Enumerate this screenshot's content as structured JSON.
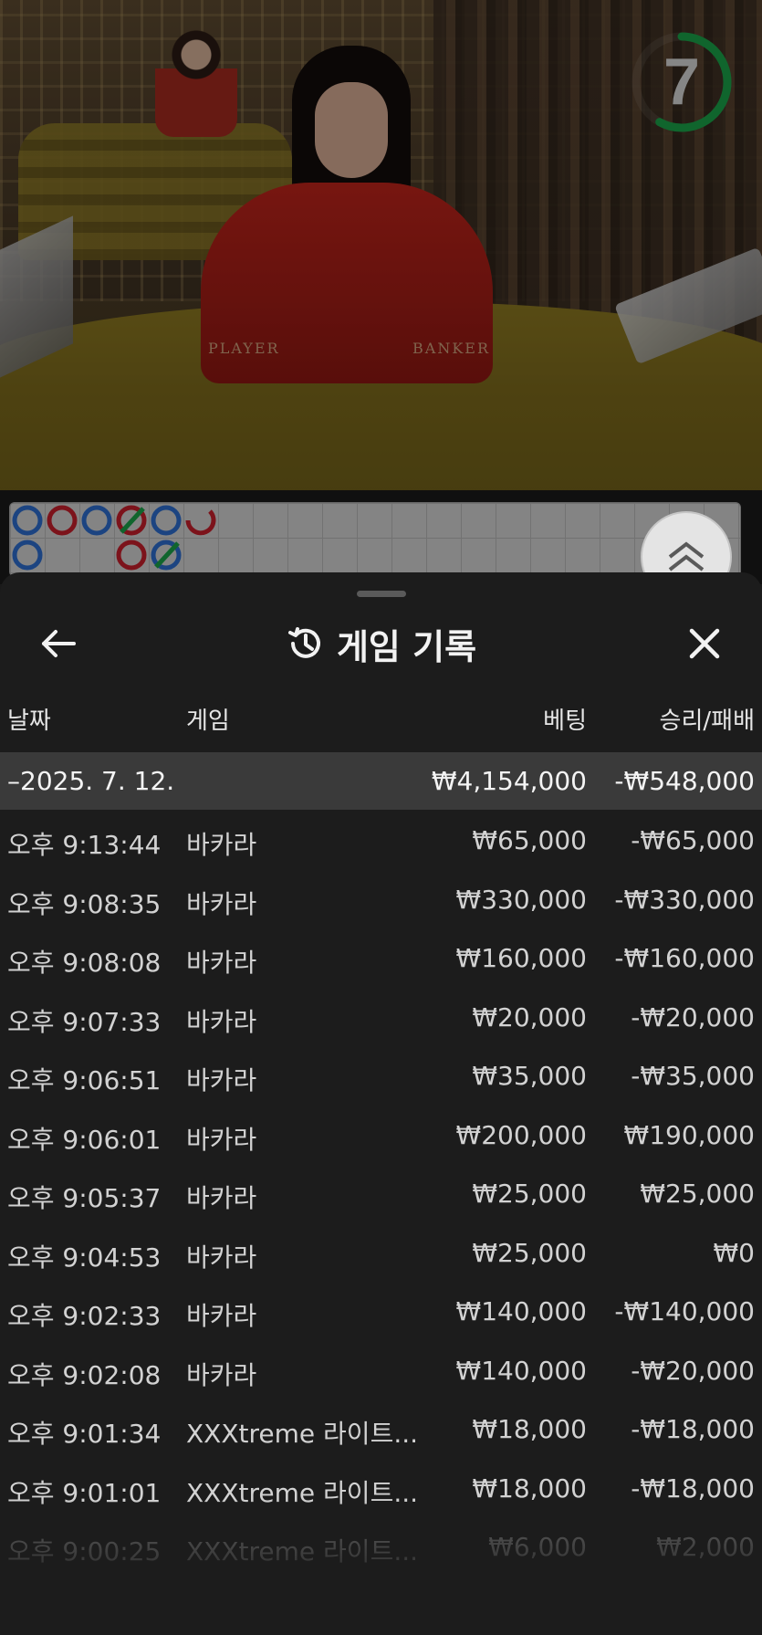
{
  "timer": {
    "countdown": "7",
    "remaining_fraction": 0.58,
    "ring_color": "#1aa34a"
  },
  "table_labels": {
    "player": "PLAYER",
    "banker": "BANKER"
  },
  "colors": {
    "player_blue": "#2e6fd1",
    "banker_red": "#c8202c",
    "tie_green": "#1aa34a",
    "sheet_bg": "#1c1c1c",
    "day_row_bg": "#3a3a3a"
  },
  "history": {
    "title": "게임 기록",
    "icons": {
      "back": "arrow-left-icon",
      "title": "history-icon",
      "close": "close-icon",
      "expand": "chevron-double-up-icon"
    },
    "columns": {
      "date": "날짜",
      "game": "게임",
      "bet": "베팅",
      "win_loss": "승리/패배"
    },
    "day": {
      "date": "–2025. 7. 12.",
      "bet": "₩4,154,000",
      "win_loss": "-₩548,000"
    },
    "rows": [
      {
        "time": "오후 9:13:44",
        "game": "바카라",
        "bet": "₩65,000",
        "win_loss": "-₩65,000"
      },
      {
        "time": "오후 9:08:35",
        "game": "바카라",
        "bet": "₩330,000",
        "win_loss": "-₩330,000"
      },
      {
        "time": "오후 9:08:08",
        "game": "바카라",
        "bet": "₩160,000",
        "win_loss": "-₩160,000"
      },
      {
        "time": "오후 9:07:33",
        "game": "바카라",
        "bet": "₩20,000",
        "win_loss": "-₩20,000"
      },
      {
        "time": "오후 9:06:51",
        "game": "바카라",
        "bet": "₩35,000",
        "win_loss": "-₩35,000"
      },
      {
        "time": "오후 9:06:01",
        "game": "바카라",
        "bet": "₩200,000",
        "win_loss": "₩190,000"
      },
      {
        "time": "오후 9:05:37",
        "game": "바카라",
        "bet": "₩25,000",
        "win_loss": "₩25,000"
      },
      {
        "time": "오후 9:04:53",
        "game": "바카라",
        "bet": "₩25,000",
        "win_loss": "₩0"
      },
      {
        "time": "오후 9:02:33",
        "game": "바카라",
        "bet": "₩140,000",
        "win_loss": "-₩140,000"
      },
      {
        "time": "오후 9:02:08",
        "game": "바카라",
        "bet": "₩140,000",
        "win_loss": "-₩20,000"
      },
      {
        "time": "오후 9:01:34",
        "game": "XXXtreme 라이트...",
        "bet": "₩18,000",
        "win_loss": "-₩18,000"
      },
      {
        "time": "오후 9:01:01",
        "game": "XXXtreme 라이트...",
        "bet": "₩18,000",
        "win_loss": "-₩18,000"
      },
      {
        "time": "오후 9:00:25",
        "game": "XXXtreme 라이트...",
        "bet": "₩6,000",
        "win_loss": "₩2,000"
      }
    ]
  }
}
